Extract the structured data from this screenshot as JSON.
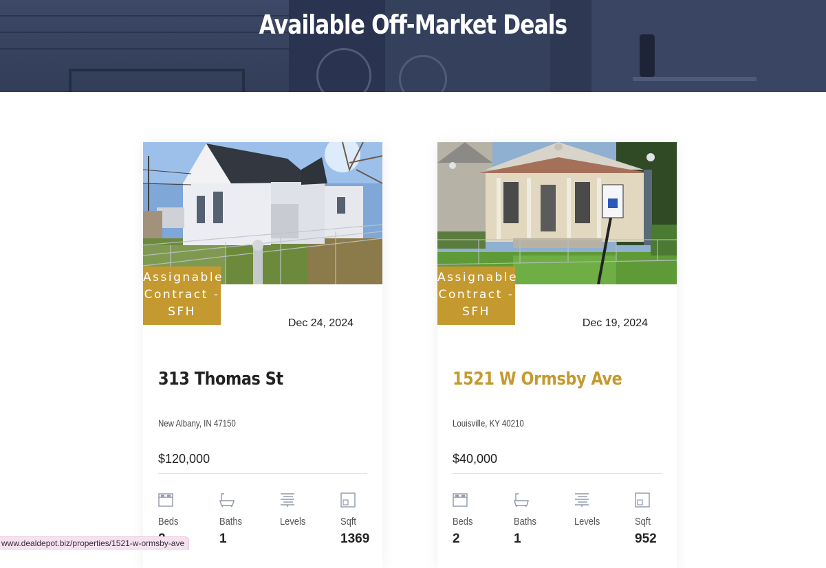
{
  "page_title": "Available Off-Market Deals",
  "status_bar_url": "www.dealdepot.biz/properties/1521-w-ormsby-ave",
  "colors": {
    "accent": "#c49a30",
    "hero_bg": "#34405c"
  },
  "stat_labels": {
    "beds": "Beds",
    "baths": "Baths",
    "levels": "Levels",
    "sqft": "Sqft"
  },
  "listings": [
    {
      "badge_line1": "Assignable",
      "badge_line2": "Contract -",
      "badge_line3": "SFH",
      "date": "Dec 24, 2024",
      "address": "313 Thomas St",
      "location": "New Albany, IN 47150",
      "price": "$120,000",
      "beds": "2",
      "baths": "1",
      "levels": "",
      "sqft": "1369"
    },
    {
      "badge_line1": "Assignable",
      "badge_line2": "Contract -",
      "badge_line3": "SFH",
      "date": "Dec 19, 2024",
      "address": "1521 W Ormsby Ave",
      "location": "Louisville, KY 40210",
      "price": "$40,000",
      "beds": "2",
      "baths": "1",
      "levels": "",
      "sqft": "952"
    }
  ]
}
